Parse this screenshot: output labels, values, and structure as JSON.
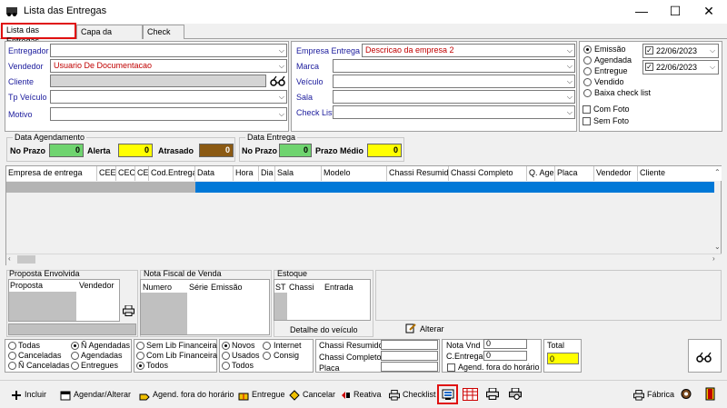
{
  "window": {
    "title": "Lista das Entregas",
    "minimize": "—",
    "maximize": "☐",
    "close": "✕"
  },
  "tabs": [
    {
      "label": "Lista das Entregas"
    },
    {
      "label": "Capa da Entrega"
    },
    {
      "label": "Check List"
    }
  ],
  "filters_left": {
    "entregador": {
      "label": "Entregador",
      "value": ""
    },
    "vendedor": {
      "label": "Vendedor",
      "value": "Usuario De Documentacao"
    },
    "cliente": {
      "label": "Cliente",
      "value": ""
    },
    "tp_veiculo": {
      "label": "Tp Veículo",
      "value": ""
    },
    "motivo": {
      "label": "Motivo",
      "value": ""
    }
  },
  "filters_mid": {
    "empresa": {
      "label": "Empresa Entrega",
      "value": "Descricao da empresa 2"
    },
    "marca": {
      "label": "Marca",
      "value": ""
    },
    "veiculo": {
      "label": "Veículo",
      "value": ""
    },
    "sala": {
      "label": "Sala",
      "value": ""
    },
    "checklist": {
      "label": "Check List",
      "value": ""
    }
  },
  "status_radios": [
    {
      "label": "Emissão",
      "checked": true
    },
    {
      "label": "Agendada",
      "checked": false
    },
    {
      "label": "Entregue",
      "checked": false
    },
    {
      "label": "Vendido",
      "checked": false
    },
    {
      "label": "Baixa check list",
      "checked": false
    }
  ],
  "dates": {
    "from": "22/06/2023",
    "to": "22/06/2023"
  },
  "foto": {
    "com": "Com Foto",
    "sem": "Sem Foto"
  },
  "agendamento": {
    "title": "Data Agendamento",
    "no_prazo_label": "No Prazo",
    "no_prazo": "0",
    "alerta_label": "Alerta",
    "alerta": "0",
    "atrasado_label": "Atrasado",
    "atrasado": "0"
  },
  "entrega": {
    "title": "Data Entrega",
    "no_prazo_label": "No Prazo",
    "no_prazo": "0",
    "prazo_medio_label": "Prazo Médio",
    "prazo_medio": "0"
  },
  "grid_columns": [
    "Empresa de entrega",
    "CEE",
    "CEO",
    "CE",
    "Cod.Entrega",
    "Data",
    "Hora",
    "Dia",
    "Sala",
    "Modelo",
    "Chassi Resumido",
    "Chassi Completo",
    "Q. Age",
    "Placa",
    "Vendedor",
    "Cliente"
  ],
  "proposta": {
    "title": "Proposta Envolvida",
    "cols": [
      "Proposta",
      "Vendedor"
    ]
  },
  "nota": {
    "title": "Nota Fiscal de Venda",
    "cols": [
      "Numero",
      "Série",
      "Emissão"
    ]
  },
  "estoque": {
    "title": "Estoque",
    "cols": [
      "ST",
      "Chassi",
      "Entrada"
    ],
    "detalhe": "Detalhe do veículo"
  },
  "alterar": "Alterar",
  "bottom": {
    "r1": [
      "Todas",
      "Canceladas",
      "Ñ Canceladas"
    ],
    "r2": [
      "Ñ Agendadas",
      "Agendadas",
      "Entregues"
    ],
    "r3": [
      "Sem Lib Financeira",
      "Com Lib Financeira",
      "Todos"
    ],
    "r4": [
      "Novos",
      "Usados",
      "Todos"
    ],
    "r5": [
      "Internet",
      "Consig"
    ],
    "chassi_resumido": "Chassi Resumido",
    "chassi_completo": "Chassi Completo",
    "placa": "Placa",
    "nota_vnd_label": "Nota Vnd",
    "nota_vnd": "0",
    "c_entrega_label": "C.Entrega",
    "c_entrega": "0",
    "agend_fora": "Agend. fora do horário",
    "total_label": "Total",
    "total": "0"
  },
  "toolbar": {
    "incluir": "Incluir",
    "agendar": "Agendar/Alterar",
    "agend_fora": "Agend. fora do horário",
    "entregue": "Entregue",
    "cancelar": "Cancelar",
    "reativa": "Reativa",
    "checklist": "Checklist",
    "fabrica": "Fábrica"
  }
}
